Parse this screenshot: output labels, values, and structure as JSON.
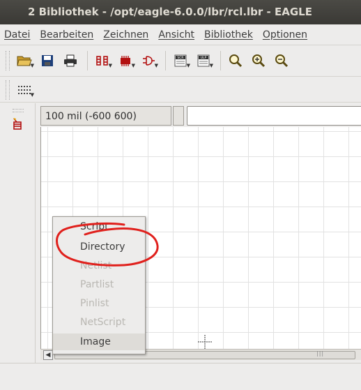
{
  "window": {
    "title": "2 Bibliothek - /opt/eagle-6.0.0/lbr/rcl.lbr - EAGLE"
  },
  "menubar": {
    "items": [
      {
        "label": "Datei"
      },
      {
        "label": "Bearbeiten"
      },
      {
        "label": "Zeichnen"
      },
      {
        "label": "Ansicht"
      },
      {
        "label": "Bibliothek"
      },
      {
        "label": "Optionen"
      }
    ]
  },
  "toolbar": {
    "buttons": [
      {
        "icon": "open-folder-icon"
      },
      {
        "icon": "save-icon"
      },
      {
        "icon": "print-icon"
      },
      {
        "icon": "device-icon"
      },
      {
        "icon": "package-icon"
      },
      {
        "icon": "symbol-icon"
      },
      {
        "icon": "script-icon",
        "text": "SCR"
      },
      {
        "icon": "ulp-icon",
        "text": "ULP"
      },
      {
        "icon": "zoom-fit-icon"
      },
      {
        "icon": "zoom-in-icon"
      },
      {
        "icon": "zoom-out-icon"
      }
    ]
  },
  "coords": {
    "grid_readout": "100 mil (-600 600)"
  },
  "context_menu": {
    "items": [
      {
        "label": "Script",
        "enabled": true
      },
      {
        "label": "Directory",
        "enabled": true
      },
      {
        "label": "Netlist",
        "enabled": false
      },
      {
        "label": "Partlist",
        "enabled": false
      },
      {
        "label": "Pinlist",
        "enabled": false
      },
      {
        "label": "NetScript",
        "enabled": false
      },
      {
        "label": "Image",
        "enabled": true
      }
    ]
  },
  "colors": {
    "titlebar": "#3f3e3a",
    "annotation": "#e0201c",
    "menu_disabled": "#b9b7b2"
  }
}
